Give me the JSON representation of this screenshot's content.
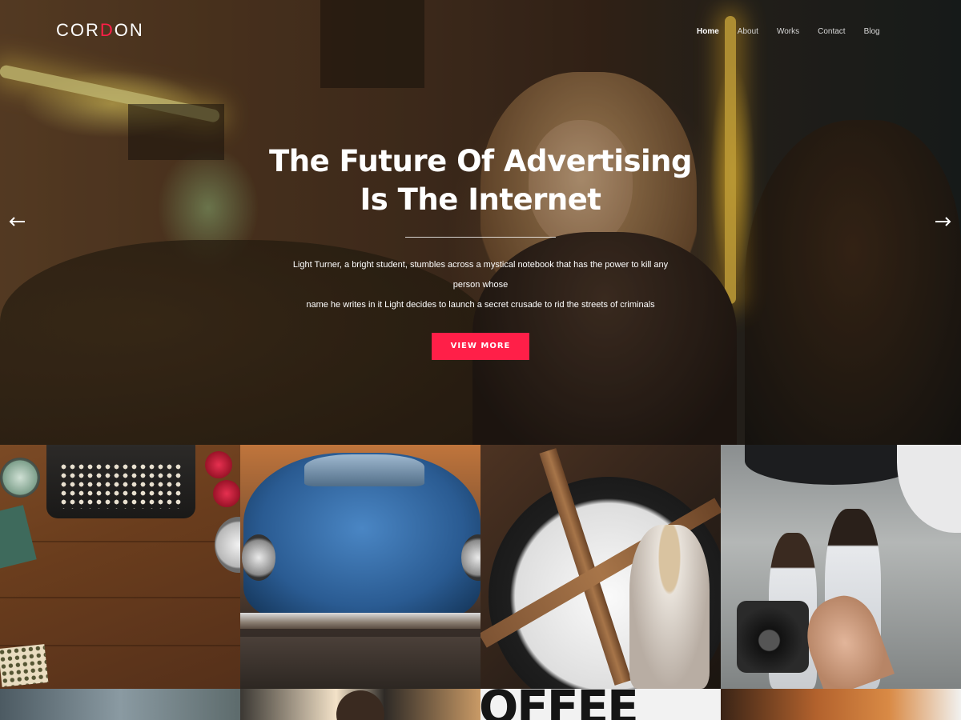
{
  "brand": {
    "logo_part1": "COR",
    "logo_accent": "D",
    "logo_part2": "ON"
  },
  "nav": {
    "items": [
      {
        "label": "Home",
        "active": true
      },
      {
        "label": "About",
        "active": false
      },
      {
        "label": "Works",
        "active": false
      },
      {
        "label": "Contact",
        "active": false
      },
      {
        "label": "Blog",
        "active": false
      }
    ]
  },
  "hero": {
    "title_line1": "The Future Of Advertising",
    "title_line2": "Is The Internet",
    "description_line1": "Light Turner, a bright student, stumbles across a mystical notebook that has the power to kill any person whose",
    "description_line2": "name he writes in it Light decides to launch a secret crusade to rid the streets of criminals",
    "button_label": "VIEW MORE",
    "prev_icon": "arrow-left-icon",
    "next_icon": "arrow-right-icon"
  },
  "gallery": {
    "tiles": [
      {
        "name": "typewriter-desk-photo"
      },
      {
        "name": "blue-beetle-car-photo"
      },
      {
        "name": "clock-tower-model-photo"
      },
      {
        "name": "fashion-photoshoot-photo"
      },
      {
        "name": "city-street-photo"
      },
      {
        "name": "man-portrait-photo"
      },
      {
        "name": "coffee-sign-photo",
        "text": "OFFEE"
      },
      {
        "name": "orange-smoke-photo"
      }
    ]
  },
  "colors": {
    "accent": "#ff1f48",
    "text_light": "#ffffff",
    "nav_muted": "#d8d8d8"
  }
}
